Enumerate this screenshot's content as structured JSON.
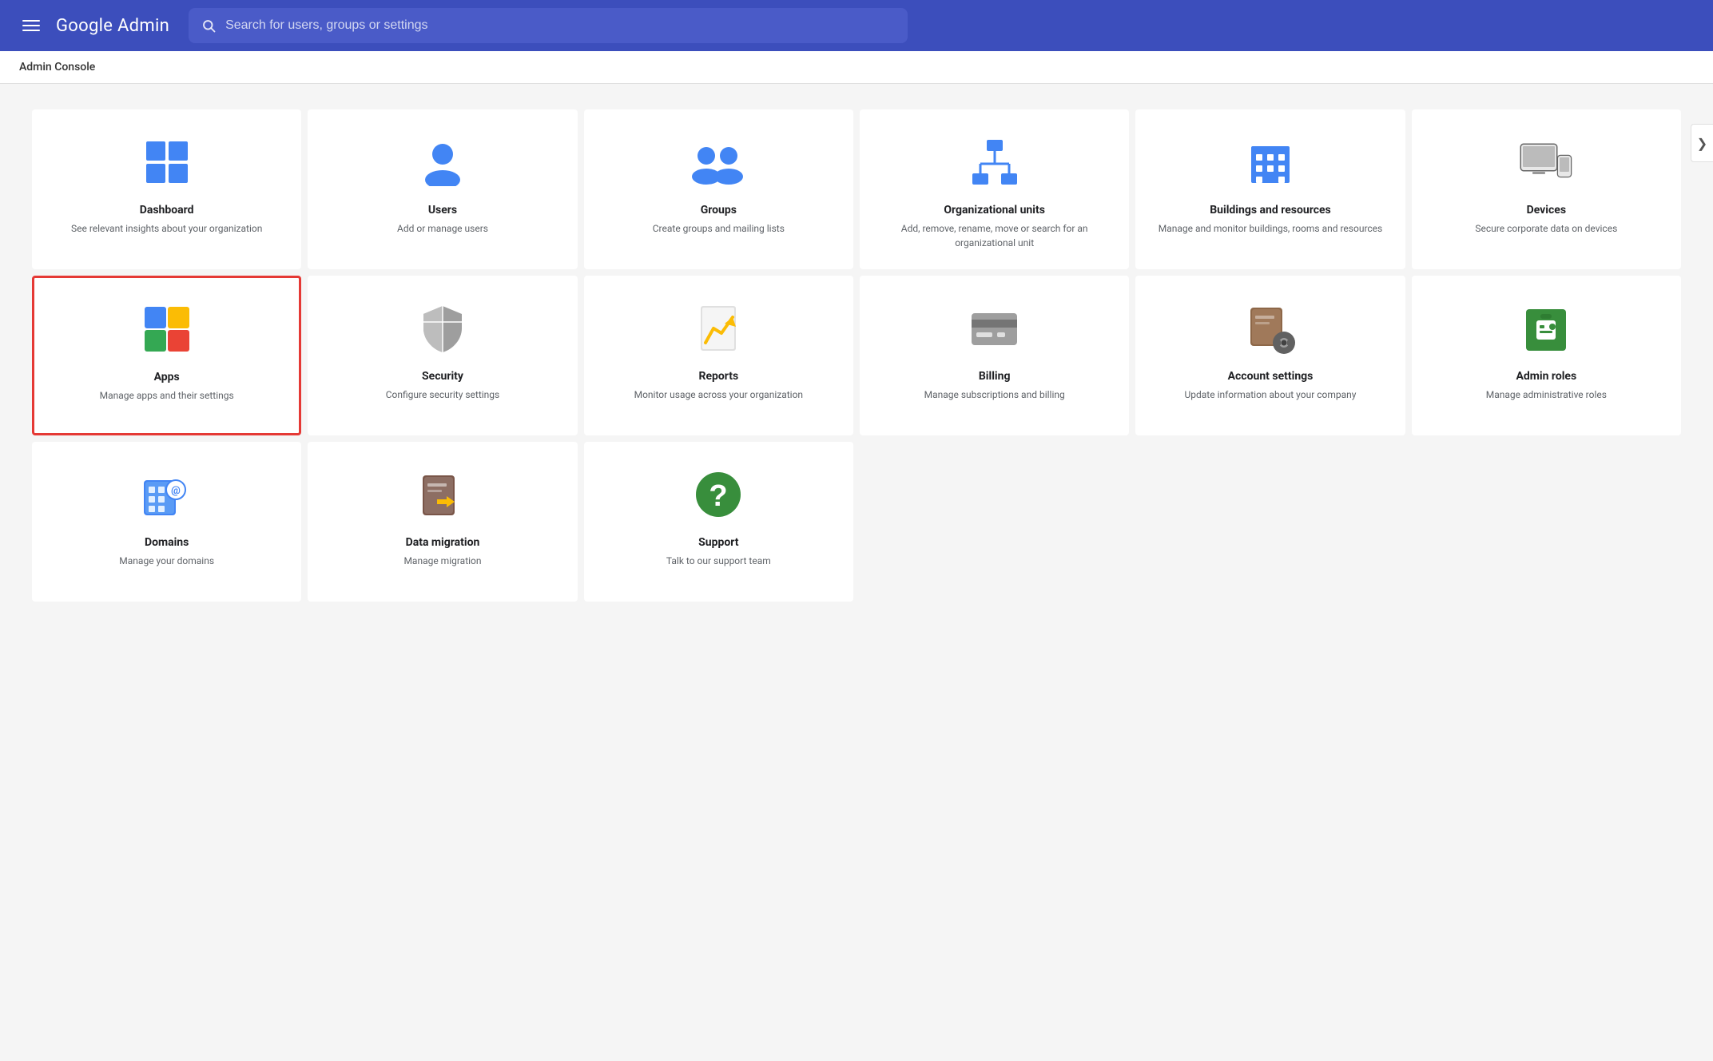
{
  "header": {
    "menu_label": "Menu",
    "logo_text": "Google Admin",
    "search_placeholder": "Search for users, groups or settings"
  },
  "subheader": {
    "title": "Admin Console"
  },
  "cards": [
    {
      "id": "dashboard",
      "title": "Dashboard",
      "desc": "See relevant insights about your organization",
      "selected": false,
      "row": 0
    },
    {
      "id": "users",
      "title": "Users",
      "desc": "Add or manage users",
      "selected": false,
      "row": 0
    },
    {
      "id": "groups",
      "title": "Groups",
      "desc": "Create groups and mailing lists",
      "selected": false,
      "row": 0
    },
    {
      "id": "org-units",
      "title": "Organizational units",
      "desc": "Add, remove, rename, move or search for an organizational unit",
      "selected": false,
      "row": 0
    },
    {
      "id": "buildings",
      "title": "Buildings and resources",
      "desc": "Manage and monitor buildings, rooms and resources",
      "selected": false,
      "row": 0
    },
    {
      "id": "devices",
      "title": "Devices",
      "desc": "Secure corporate data on devices",
      "selected": false,
      "row": 0
    },
    {
      "id": "apps",
      "title": "Apps",
      "desc": "Manage apps and their settings",
      "selected": true,
      "row": 1
    },
    {
      "id": "security",
      "title": "Security",
      "desc": "Configure security settings",
      "selected": false,
      "row": 1
    },
    {
      "id": "reports",
      "title": "Reports",
      "desc": "Monitor usage across your organization",
      "selected": false,
      "row": 1
    },
    {
      "id": "billing",
      "title": "Billing",
      "desc": "Manage subscriptions and billing",
      "selected": false,
      "row": 1
    },
    {
      "id": "account-settings",
      "title": "Account settings",
      "desc": "Update information about your company",
      "selected": false,
      "row": 1
    },
    {
      "id": "admin-roles",
      "title": "Admin roles",
      "desc": "Manage administrative roles",
      "selected": false,
      "row": 1
    },
    {
      "id": "domains",
      "title": "Domains",
      "desc": "Manage your domains",
      "selected": false,
      "row": 2
    },
    {
      "id": "data-migration",
      "title": "Data migration",
      "desc": "Manage migration",
      "selected": false,
      "row": 2
    },
    {
      "id": "support",
      "title": "Support",
      "desc": "Talk to our support team",
      "selected": false,
      "row": 2
    }
  ],
  "chevron": "❯"
}
